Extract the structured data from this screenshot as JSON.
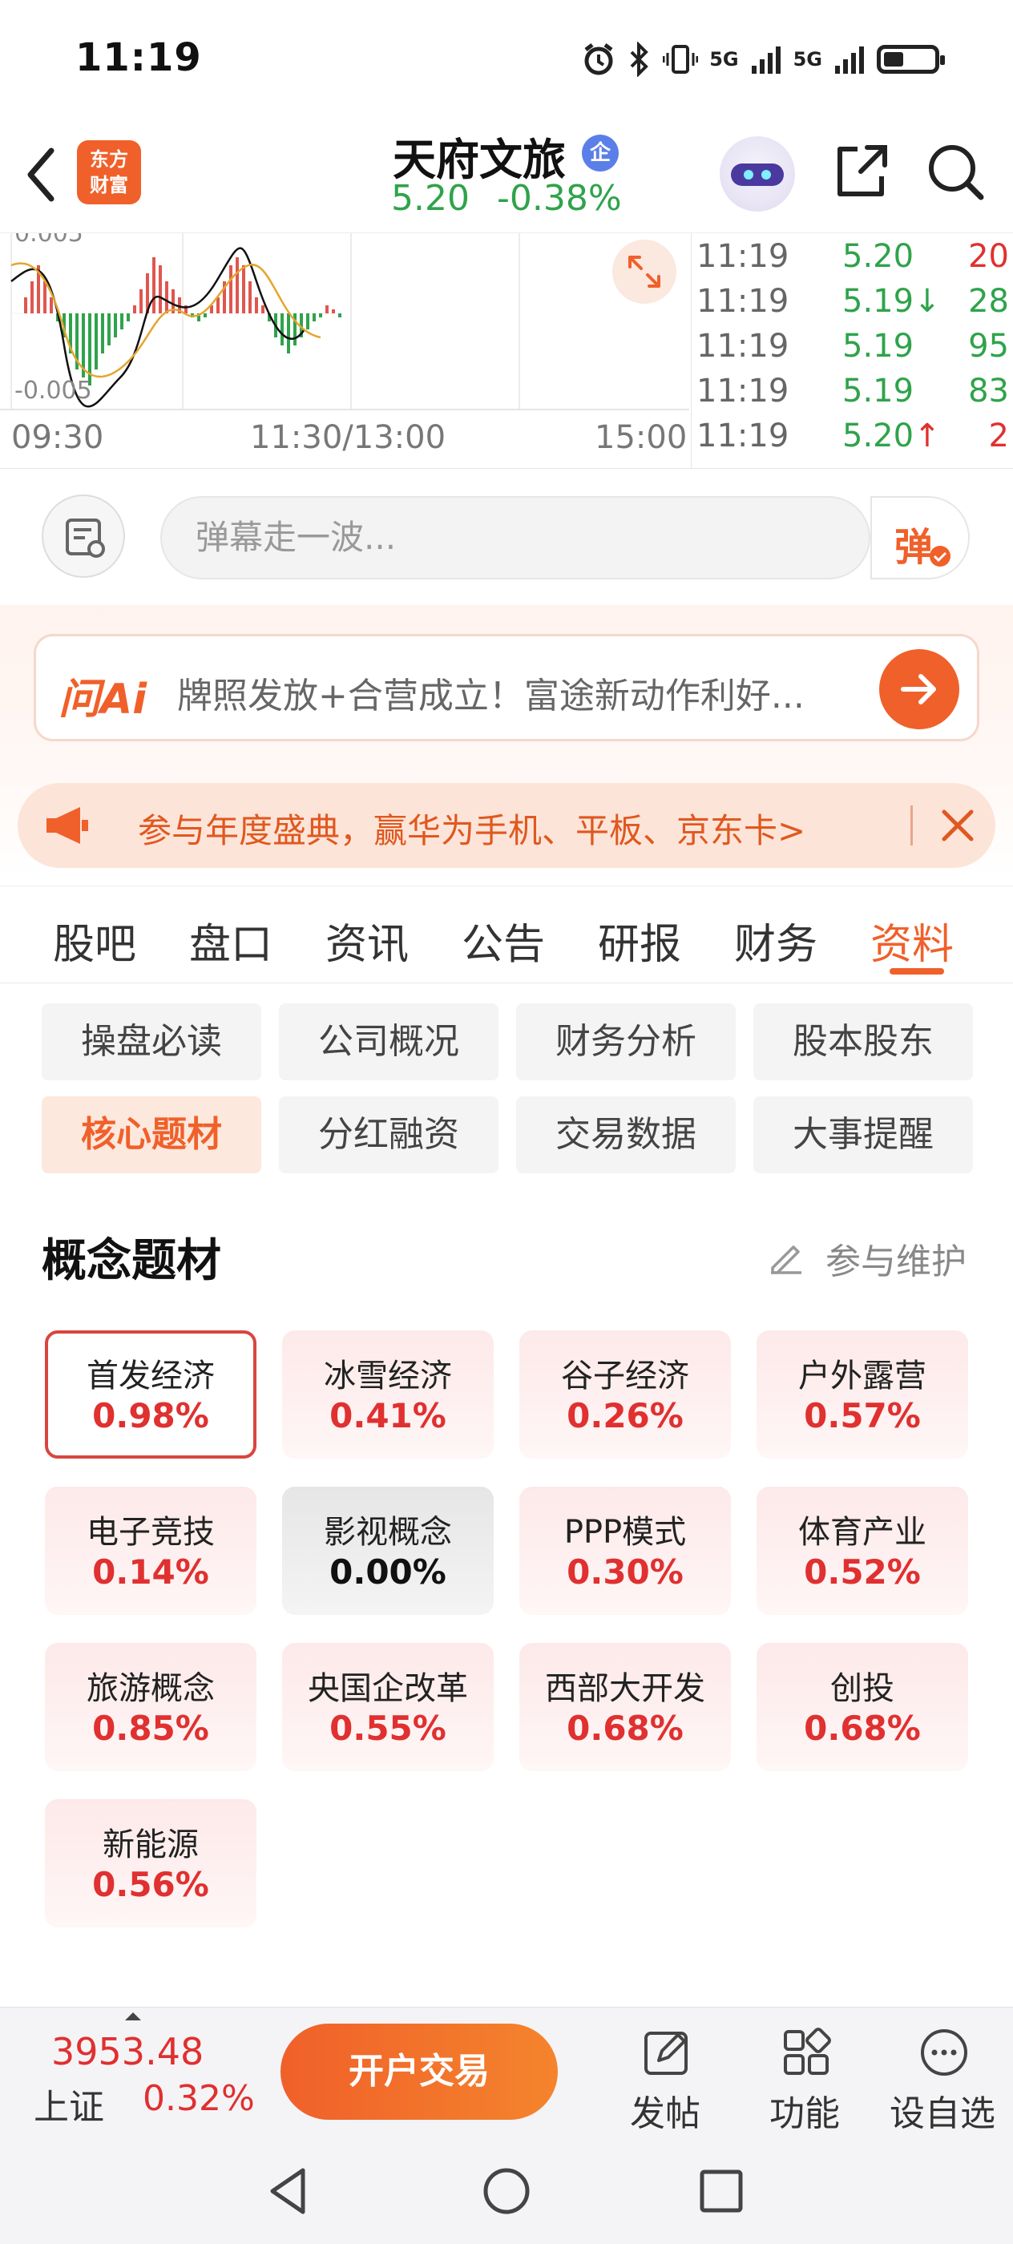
{
  "status": {
    "time": "11:19",
    "net1": "5G",
    "net2": "5G"
  },
  "header": {
    "logo_line1": "东方",
    "logo_line2": "财富",
    "stock_name": "天府文旅",
    "badge": "企",
    "price": "5.20",
    "change": "-0.38%"
  },
  "chart": {
    "y_top_label": "0.005",
    "y_bottom_label": "-0.005",
    "times": [
      "09:30",
      "11:30/13:00",
      "15:00"
    ]
  },
  "ticks": [
    {
      "time": "11:19",
      "price": "5.20",
      "arrow": "",
      "vol": "20",
      "price_color": "green",
      "vol_color": "red"
    },
    {
      "time": "11:19",
      "price": "5.19",
      "arrow": "↓",
      "vol": "28",
      "price_color": "green",
      "vol_color": "green"
    },
    {
      "time": "11:19",
      "price": "5.19",
      "arrow": "",
      "vol": "95",
      "price_color": "green",
      "vol_color": "green"
    },
    {
      "time": "11:19",
      "price": "5.19",
      "arrow": "",
      "vol": "83",
      "price_color": "green",
      "vol_color": "green"
    },
    {
      "time": "11:19",
      "price": "5.20",
      "arrow": "↑",
      "vol": "2",
      "price_color": "green",
      "vol_color": "red"
    }
  ],
  "danmaku": {
    "placeholder": "弹幕走一波...",
    "send_label": "弹"
  },
  "ai": {
    "logo": "问Ai",
    "text": "牌照发放+合营成立！富途新动作利好..."
  },
  "banner": {
    "text": "参与年度盛典，赢华为手机、平板、京东卡>"
  },
  "tabs": [
    "股吧",
    "盘口",
    "资讯",
    "公告",
    "研报",
    "财务",
    "资料"
  ],
  "active_tab": "资料",
  "subtabs": [
    {
      "label": "操盘必读",
      "active": false
    },
    {
      "label": "公司概况",
      "active": false
    },
    {
      "label": "财务分析",
      "active": false
    },
    {
      "label": "股本股东",
      "active": false
    },
    {
      "label": "核心题材",
      "active": true
    },
    {
      "label": "分红融资",
      "active": false
    },
    {
      "label": "交易数据",
      "active": false
    },
    {
      "label": "大事提醒",
      "active": false
    }
  ],
  "concept_section": {
    "title": "概念题材",
    "maintain_label": "参与维护"
  },
  "concepts": [
    {
      "name": "首发经济",
      "value": "0.98%"
    },
    {
      "name": "冰雪经济",
      "value": "0.41%"
    },
    {
      "name": "谷子经济",
      "value": "0.26%"
    },
    {
      "name": "户外露营",
      "value": "0.57%"
    },
    {
      "name": "电子竞技",
      "value": "0.14%"
    },
    {
      "name": "影视概念",
      "value": "0.00%"
    },
    {
      "name": "PPP模式",
      "value": "0.30%"
    },
    {
      "name": "体育产业",
      "value": "0.52%"
    },
    {
      "name": "旅游概念",
      "value": "0.85%"
    },
    {
      "name": "央国企改革",
      "value": "0.55%"
    },
    {
      "name": "西部大开发",
      "value": "0.68%"
    },
    {
      "name": "创投",
      "value": "0.68%"
    },
    {
      "name": "新能源",
      "value": "0.56%"
    }
  ],
  "bottom": {
    "index_value": "3953.48",
    "index_name": "上证",
    "index_pct": "0.32%",
    "trade_label": "开户交易",
    "post_label": "发帖",
    "func_label": "功能",
    "watch_label": "设自选"
  },
  "colors": {
    "accent": "#f0602a",
    "up": "#e03030",
    "down": "#2fa34b"
  }
}
